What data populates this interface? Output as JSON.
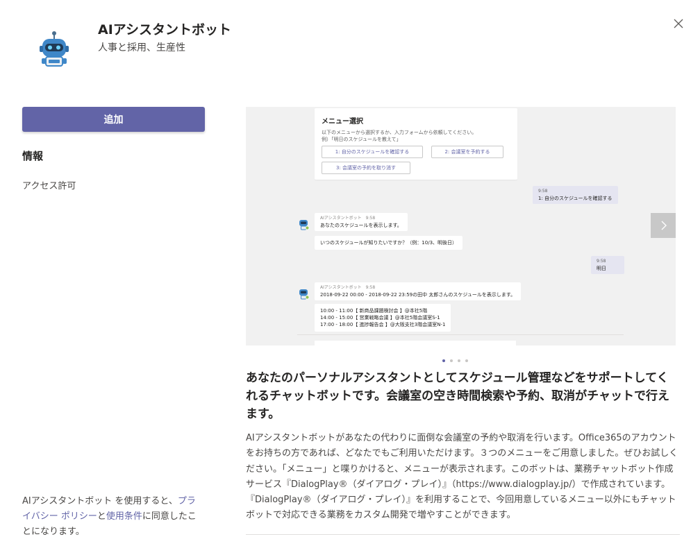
{
  "app": {
    "title": "AIアシスタントボット",
    "category": "人事と採用、生産性",
    "icon": "robot-icon"
  },
  "actions": {
    "add_label": "追加",
    "close_icon": "close-icon"
  },
  "sidebar": {
    "info_heading": "情報",
    "access_label": "アクセス許可"
  },
  "consent": {
    "prefix": "AIアシスタントボット を使用すると、",
    "privacy_link": "プライバシー ポリシー",
    "middle": "と",
    "terms_link": "使用条件",
    "suffix": "に同意したことになります。"
  },
  "carousel": {
    "menu_card": {
      "title": "メニュー選択",
      "description_line1": "以下のメニューから選択するか、入力フォームから依頼してください。",
      "description_line2": "例）「明日のスケジュールを教えて」",
      "buttons": [
        "1: 自分のスケジュールを確認する",
        "2: 会議室を予約する",
        "3: 会議室の予約を取り消す"
      ]
    },
    "user_msg_1": {
      "time": "9:58",
      "text": "1: 自分のスケジュールを確認する"
    },
    "bot_msg_1": {
      "sender": "AIアシスタントボット",
      "time": "9:58",
      "text": "あなたのスケジュールを表示します。"
    },
    "bot_msg_1b": {
      "text": "いつのスケジュールが知りたいですか？（例：10/3、明後日）"
    },
    "user_msg_2": {
      "time": "9:58",
      "text": "明日"
    },
    "bot_msg_2": {
      "sender": "AIアシスタントボット",
      "time": "9:58",
      "text": "2018-09-22 00:00 - 2018-09-22 23:59の田中 太郎さんのスケジュールを表示します。"
    },
    "schedule": [
      "10:00 - 11:00【 新商品課題検討会 】@本社5階",
      "14:00 - 15:00【 営業戦略会議 】@本社5階会議室S-1",
      "17:00 - 18:00【 進捗報告会 】@大阪支社3階会議室N-1"
    ],
    "next_icon": "chevron-right-icon",
    "page_count": 4,
    "active_page": 1
  },
  "description": {
    "headline": "あなたのパーソナルアシスタントとしてスケジュール管理などをサポートしてくれるチャットボットです。会議室の空き時間検索や予約、取消がチャットで行えます。",
    "body": "AIアシスタントボットがあなたの代わりに面倒な会議室の予約や取消を行います。Office365のアカウントをお持ちの方であれば、どなたでもご利用いただけます。３つのメニューをご用意しました。ぜひお試しください。「メニュー」と喋りかけると、メニューが表示されます。このボットは、業務チャットボット作成サービス『DialogPlay®（ダイアログ・プレイ）』（https://www.dialogplay.jp/）で作成されています。『DialogPlay®（ダイアログ・プレイ）』を利用することで、今回用意しているメニュー以外にもチャットボットで対応できる業務をカスタム開発で増やすことができます。"
  },
  "colors": {
    "accent": "#6264a7",
    "robot_blue": "#3f87c8"
  }
}
